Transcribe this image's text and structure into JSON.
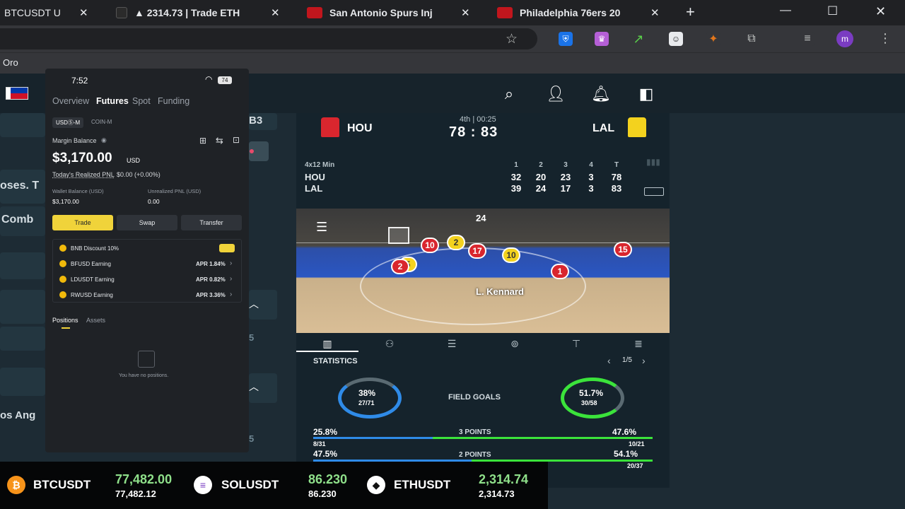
{
  "browser": {
    "tabs": [
      {
        "title": "BTCUSDT U",
        "fav_color": "#f0b90b"
      },
      {
        "title": "▲ 2314.73 | Trade ETH",
        "fav_color": "#222"
      },
      {
        "title": "San Antonio Spurs Inj",
        "fav_color": "#c1161d"
      },
      {
        "title": "Philadelphia 76ers 20",
        "fav_color": "#c1161d"
      }
    ],
    "new_tab": "+",
    "close_glyph": "✕",
    "win_min": "—",
    "win_max": "☐",
    "win_close": "✕",
    "bookmark_label": "Oro"
  },
  "bg_app": {
    "frag_oses": "oses. T",
    "frag_comb": "Comb",
    "frag_losang": "os Ang",
    "frag_b3": "B3",
    "frag_5": "5",
    "frag_5b": "5"
  },
  "scoreboard": {
    "period": "4th | 00:25",
    "home": "HOU",
    "away": "LAL",
    "score": "78 : 83",
    "format": "4x12 Min",
    "quarters": [
      "1",
      "2",
      "3",
      "4",
      "T"
    ],
    "home_q": [
      "32",
      "20",
      "23",
      "3",
      "78"
    ],
    "away_q": [
      "39",
      "24",
      "17",
      "3",
      "83"
    ],
    "shot_clock": "24",
    "featured_player": "L. Kennard",
    "players": [
      {
        "n": "5",
        "team": "yel"
      },
      {
        "n": "10",
        "team": "red"
      },
      {
        "n": "2",
        "team": "yel"
      },
      {
        "n": "17",
        "team": "red"
      },
      {
        "n": "10",
        "team": "yel"
      },
      {
        "n": "15",
        "team": "red"
      },
      {
        "n": "1",
        "team": "red"
      },
      {
        "n": "2",
        "team": "red"
      }
    ],
    "stats_title": "STATISTICS",
    "stats_page": "1/5",
    "fg_label": "FIELD GOALS",
    "fg_home_pct": "38%",
    "fg_home_made": "27/71",
    "fg_away_pct": "51.7%",
    "fg_away_made": "30/58",
    "rows": [
      {
        "label": "3 POINTS",
        "home_pct": "25.8%",
        "home_made": "8/31",
        "away_pct": "47.6%",
        "away_made": "10/21",
        "home_frac": 0.352,
        "away_frac": 0.648
      },
      {
        "label": "2 POINTS",
        "home_pct": "47.5%",
        "home_made": "",
        "away_pct": "54.1%",
        "away_made": "20/37",
        "home_frac": 0.467,
        "away_frac": 0.533
      }
    ],
    "colors": {
      "home": "#2f8be8",
      "away": "#3be33b"
    }
  },
  "phone": {
    "time": "7:52",
    "battery": "74",
    "tabs": [
      "Overview",
      "Futures",
      "Spot",
      "Funding"
    ],
    "active_tab": "Futures",
    "sub_tabs": [
      "USDⓈ-M",
      "COIN-M"
    ],
    "margin_label": "Margin Balance",
    "margin_value": "$3,170.00",
    "margin_unit": "USD",
    "pnl_label": "Today's Realized PNL",
    "pnl_value": "$0.00 (+0.00%)",
    "wallet_label": "Wallet Balance (USD)",
    "wallet_value": "$3,170.00",
    "unreal_label": "Unrealized PNL (USD)",
    "unreal_value": "0.00",
    "btn_trade": "Trade",
    "btn_swap": "Swap",
    "btn_transfer": "Transfer",
    "earn": [
      {
        "name": "BNB Discount 10%",
        "apr": ""
      },
      {
        "name": "BFUSD Earning",
        "apr": "APR 1.84%"
      },
      {
        "name": "LDUSDT Earning",
        "apr": "APR 0.82%"
      },
      {
        "name": "RWUSD Earning",
        "apr": "APR 3.36%"
      }
    ],
    "pos_tabs": [
      "Positions",
      "Assets"
    ],
    "empty": "You have no positions.",
    "accent": "#f0d33a"
  },
  "ticker": [
    {
      "sym": "BTCUSDT",
      "price": "77,482.00",
      "sub": "77,482.12",
      "coin": "₿",
      "color": "#f7931a"
    },
    {
      "sym": "SOLUSDT",
      "price": "86.230",
      "sub": "86.230",
      "coin": "≡",
      "color": "#ffffff"
    },
    {
      "sym": "ETHUSDT",
      "price": "2,314.74",
      "sub": "2,314.73",
      "coin": "◆",
      "color": "#ffffff"
    }
  ]
}
